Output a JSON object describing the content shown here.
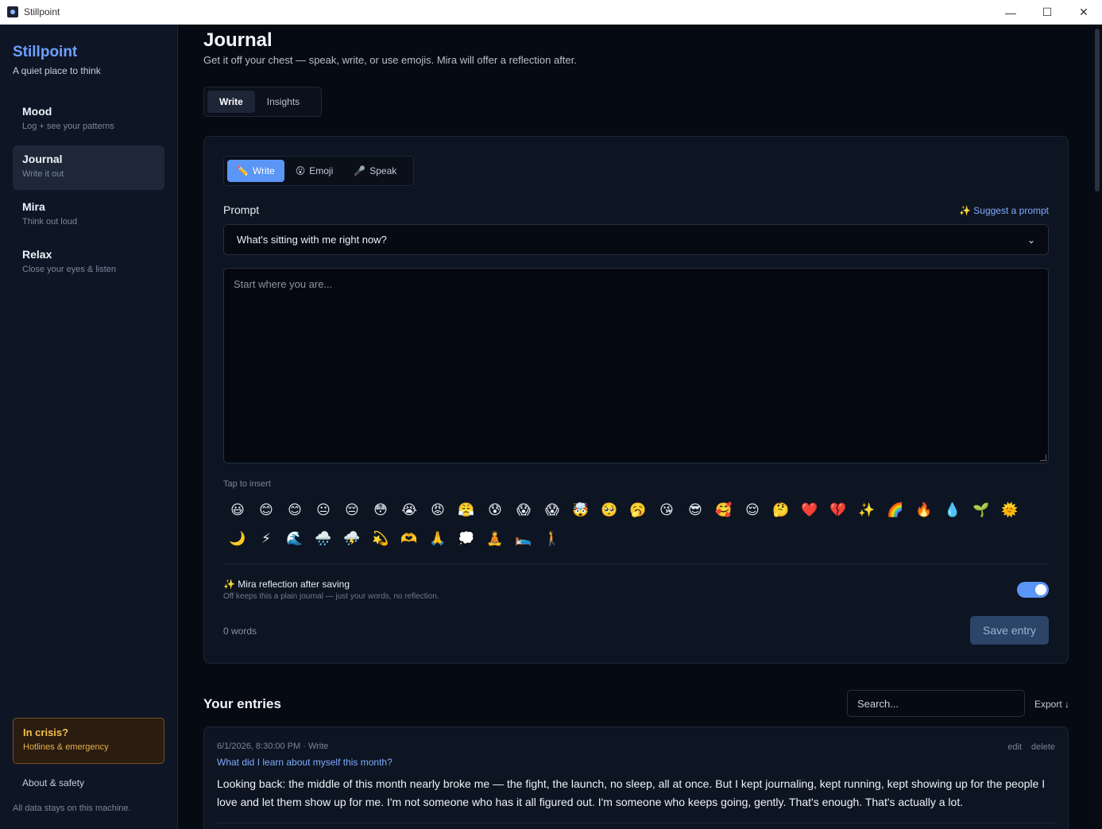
{
  "window": {
    "title": "Stillpoint",
    "minimize": "—",
    "maximize": "☐",
    "close": "✕"
  },
  "sidebar": {
    "brand": "Stillpoint",
    "tagline": "A quiet place to think",
    "items": [
      {
        "label": "Mood",
        "sub": "Log + see your patterns"
      },
      {
        "label": "Journal",
        "sub": "Write it out"
      },
      {
        "label": "Mira",
        "sub": "Think out loud"
      },
      {
        "label": "Relax",
        "sub": "Close your eyes & listen"
      }
    ],
    "crisis": {
      "title": "In crisis?",
      "sub": "Hotlines & emergency"
    },
    "about": "About & safety",
    "data_note": "All data stays on this machine."
  },
  "main": {
    "title": "Journal",
    "subtitle": "Get it off your chest — speak, write, or use emojis. Mira will offer a reflection after.",
    "tabs": [
      {
        "label": "Write"
      },
      {
        "label": "Insights"
      }
    ],
    "composer": {
      "modes": [
        {
          "icon": "✏️",
          "label": "Write"
        },
        {
          "icon": "😮",
          "label": "Emoji"
        },
        {
          "icon": "🎤",
          "label": "Speak"
        }
      ],
      "prompt_label": "Prompt",
      "suggest": "✨ Suggest a prompt",
      "prompt_value": "What's sitting with me right now?",
      "text_placeholder": "Start where you are...",
      "tap_label": "Tap to insert",
      "emojis": [
        "😃",
        "😊",
        "😊",
        "😐",
        "😔",
        "😳",
        "😭",
        "😡",
        "😤",
        "😰",
        "😱",
        "😱",
        "🤯",
        "🥺",
        "🥱",
        "😘",
        "😎",
        "🥰",
        "😌",
        "🤔",
        "❤️",
        "💔",
        "✨",
        "🌈",
        "🔥",
        "💧",
        "🌱",
        "🌞",
        "🌙",
        "⚡",
        "🌊",
        "🌧️",
        "⛈️",
        "💫",
        "🫶",
        "🙏",
        "💭",
        "🧘",
        "🛌",
        "🚶"
      ],
      "reflection_title": "✨ Mira reflection after saving",
      "reflection_sub": "Off keeps this a plain journal — just your words, no reflection.",
      "words": "0 words",
      "save": "Save entry"
    },
    "entries": {
      "title": "Your entries",
      "search_placeholder": "Search...",
      "export": "Export ↓",
      "items": [
        {
          "meta": "6/1/2026, 8:30:00 PM  ·  Write",
          "prompt": "What did I learn about myself this month?",
          "body": "Looking back: the middle of this month nearly broke me — the fight, the launch, no sleep, all at once. But I kept journaling, kept running, kept showing up for the people I love and let them show up for me. I'm not someone who has it all figured out. I'm someone who keeps going, gently. That's enough. That's actually a lot.",
          "edit": "edit",
          "delete": "delete"
        }
      ]
    }
  }
}
